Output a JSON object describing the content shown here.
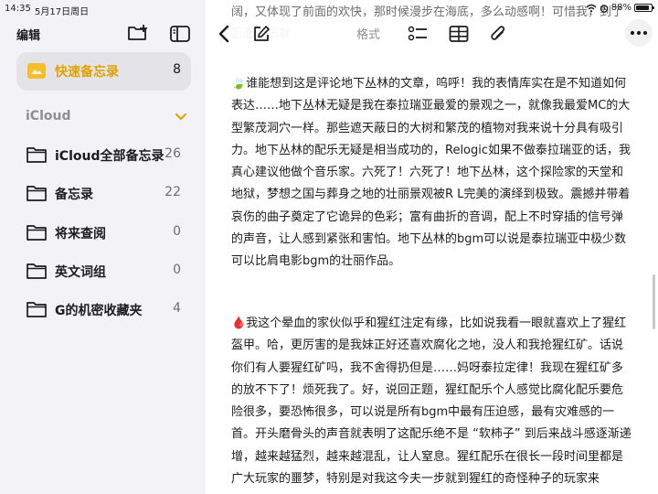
{
  "status_bar": {
    "time": "14:35",
    "date": "5月17日周日",
    "battery": "88%",
    "battery_level": 0.88
  },
  "sidebar": {
    "edit_label": "编辑",
    "quick_notes": {
      "label": "快速备忘录",
      "count": "8"
    },
    "section_title": "iCloud",
    "folders": [
      {
        "label": "iCloud全部备忘录",
        "count": "26"
      },
      {
        "label": "备忘录",
        "count": "22"
      },
      {
        "label": "将来查阅",
        "count": "0"
      },
      {
        "label": "英文词组",
        "count": "0"
      },
      {
        "label": "G的机密收藏夹",
        "count": "4"
      }
    ]
  },
  "toolbar": {
    "format_label": "格式"
  },
  "note": {
    "top_partial": "阔，又体现了前面的欢快，那时候漫步在海底，多么动感啊！可惜我，到了后面配乐就",
    "para1": "🍃谁能想到这是评论地下丛林的文章，呜呼！我的表情库实在是不知道如何表达……地下丛林无疑是我在泰拉瑞亚最爱的景观之一，就像我最爱MC的大型繁茂洞穴一样。那些遮天蔽日的大树和繁茂的植物对我来说十分具有吸引力。地下丛林的配乐无疑是相当成功的，Relogic如果不做泰拉瑞亚的话，我真心建议他做个音乐家。六死了！六死了！地下丛林，这个探险家的天堂和地狱，梦想之国与葬身之地的壮丽景观被R L完美的演绎到极致。震撼并带着哀伤的曲子奠定了它诡异的色彩；富有曲折的音调，配上不时穿插的信号弹的声音，让人感到紧张和害怕。地下丛林的bgm可以说是泰拉瑞亚中极少数可以比肩电影bgm的壮丽作品。",
    "para2": "🩸我这个晕血的家伙似乎和猩红注定有缘，比如说我看一眼就喜欢上了猩红盔甲。哈，更厉害的是我妹正好还喜欢腐化之地，没人和我抢猩红矿。话说你们有人要猩红矿吗，我不舍得扔但是……妈呀泰拉定律！我现在猩红矿多的放不下了！烦死我了。好，说回正题，猩红配乐个人感觉比腐化配乐要危险很多，要恐怖很多，可以说是所有bgm中最有压迫感，最有灾难感的一首。开头磨骨头的声音就表明了这配乐绝不是 “软柿子” 到后来战斗感逐渐递增，越来越猛烈，越来越混乱，让人窒息。猩红配乐在很长一段时间里都是广大玩家的噩梦，特别是对我这今夫一步就到猩红的奇怪种子的玩家来"
  },
  "colors": {
    "accent": "#e0a200",
    "sidebar_bg": "#f2f2f7",
    "selected_bg": "#e3e3e8"
  }
}
